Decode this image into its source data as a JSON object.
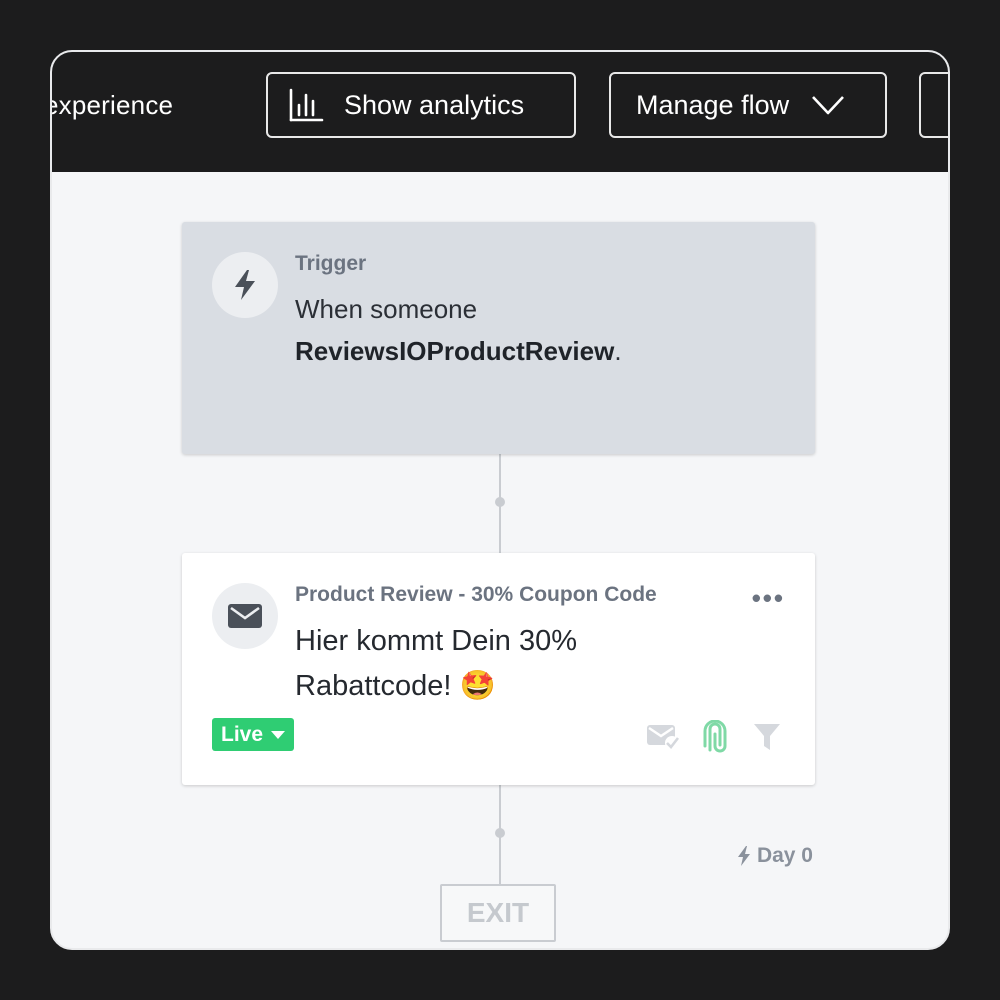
{
  "topbar": {
    "crumb": "experience",
    "analytics_label": "Show analytics",
    "manage_label": "Manage flow"
  },
  "trigger_card": {
    "label": "Trigger",
    "line1": "When someone",
    "event": "ReviewsIOProductReview",
    "suffix": "."
  },
  "email_card": {
    "label": "Product Review - 30% Coupon Code",
    "more": "•••",
    "subject": "Hier kommt Dein 30% Rabattcode! 🤩",
    "status": "Live",
    "status_color": "#2fcd73"
  },
  "delay": {
    "label": "Day 0"
  },
  "exit": {
    "label": "EXIT"
  },
  "colors": {
    "topbar_bg": "#1c1c1d",
    "canvas_bg": "#f5f6f8",
    "trigger_bg": "#d9dde3",
    "accent_green": "#2fcd73"
  }
}
